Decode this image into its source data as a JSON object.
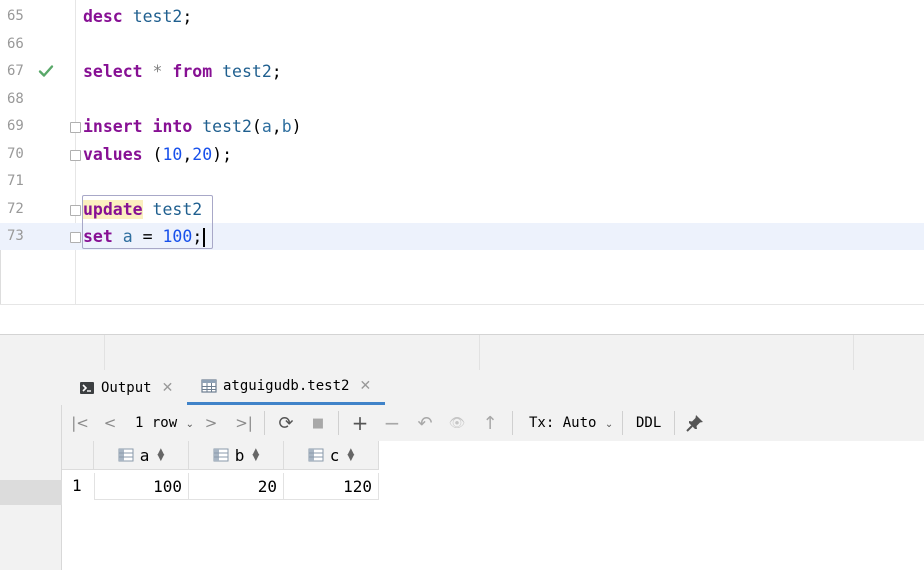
{
  "editor": {
    "lines": [
      {
        "num": "65"
      },
      {
        "num": "66"
      },
      {
        "num": "67"
      },
      {
        "num": "68"
      },
      {
        "num": "69"
      },
      {
        "num": "70"
      },
      {
        "num": "71"
      },
      {
        "num": "72"
      },
      {
        "num": "73"
      }
    ],
    "code": {
      "l65_kw": "desc",
      "l65_id": "test2",
      "l65_end": ";",
      "l67_kw1": "select",
      "l67_star": "*",
      "l67_kw2": "from",
      "l67_id": "test2",
      "l67_end": ";",
      "l69_kw1": "insert",
      "l69_kw2": "into",
      "l69_id": "test2",
      "l69_open": "(",
      "l69_a": "a",
      "l69_comma": ",",
      "l69_b": "b",
      "l69_close": ")",
      "l70_kw": "values",
      "l70_open": "(",
      "l70_n1": "10",
      "l70_comma": ",",
      "l70_n2": "20",
      "l70_close": ")",
      "l70_end": ";",
      "l72_kw": "update",
      "l72_id": "test2",
      "l73_kw": "set",
      "l73_col": "a",
      "l73_eq": "=",
      "l73_num": "100",
      "l73_end": ";"
    },
    "colors": {
      "keyword": "#871094",
      "number": "#1750eb",
      "identifier": "#1f5f8f",
      "active_line": "#edf2fc",
      "check": "#59a869"
    }
  },
  "tabs": [
    {
      "label": "Output",
      "icon": "console-icon",
      "close": "✕"
    },
    {
      "label": "atguigudb.test2",
      "icon": "table-icon",
      "close": "✕"
    }
  ],
  "toolbar": {
    "first": "|<",
    "prev": "<",
    "rows": "1 row",
    "next": ">",
    "last": ">|",
    "reload": "⟳",
    "stop": "■",
    "add": "+",
    "remove": "−",
    "revert": "↶",
    "preview": "👁",
    "submit": "↑",
    "tx_label": "Tx: Auto",
    "ddl": "DDL",
    "pin": "📌"
  },
  "grid": {
    "columns": [
      "a",
      "b",
      "c"
    ],
    "rows": [
      {
        "num": "1",
        "cells": [
          "100",
          "20",
          "120"
        ]
      }
    ]
  }
}
